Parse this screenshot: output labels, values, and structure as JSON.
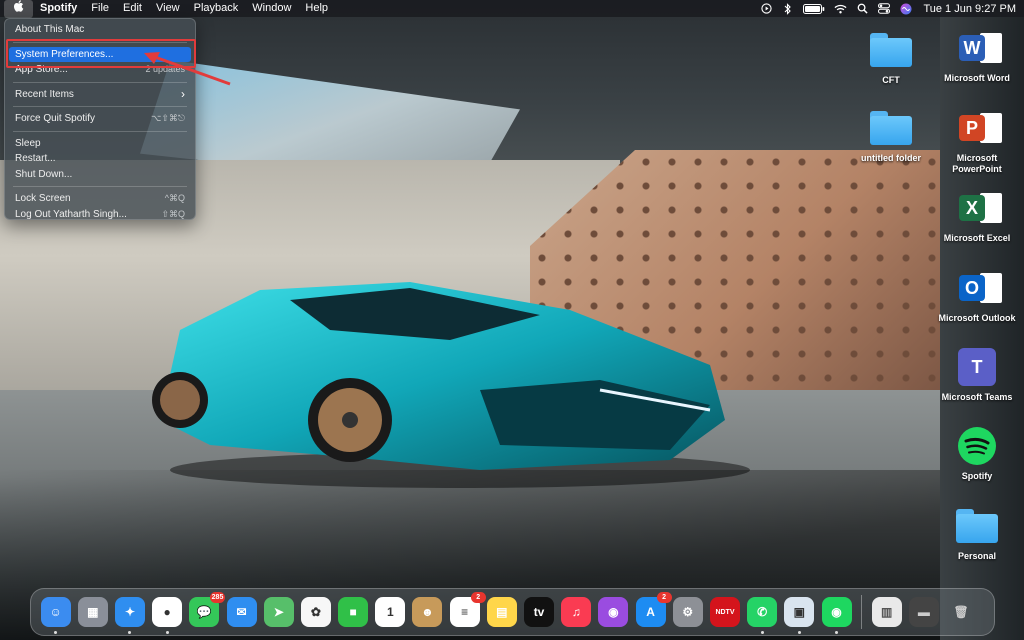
{
  "menubar": {
    "app_name": "Spotify",
    "items": [
      "File",
      "Edit",
      "View",
      "Playback",
      "Window",
      "Help"
    ],
    "status_icons": [
      "play-icon",
      "bluetooth-icon",
      "battery-icon",
      "wifi-icon",
      "spotlight-icon",
      "control-center-icon",
      "siri-icon"
    ],
    "clock": "Tue 1 Jun  9:27 PM"
  },
  "apple_menu": {
    "items": [
      {
        "label": "About This Mac",
        "shortcut": ""
      },
      {
        "label": "System Preferences...",
        "shortcut": ""
      },
      {
        "label": "App Store...",
        "shortcut": "2 updates"
      },
      {
        "label": "Recent Items",
        "shortcut": "›"
      },
      {
        "label": "Force Quit Spotify",
        "shortcut": "⌥⇧⌘⎋"
      },
      {
        "label": "Sleep",
        "shortcut": ""
      },
      {
        "label": "Restart...",
        "shortcut": ""
      },
      {
        "label": "Shut Down...",
        "shortcut": ""
      },
      {
        "label": "Lock Screen",
        "shortcut": "^⌘Q"
      },
      {
        "label": "Log Out Yatharth Singh...",
        "shortcut": "⇧⌘Q"
      }
    ]
  },
  "desktop_icons": [
    {
      "label": "CFT",
      "icon": "folder-icon"
    },
    {
      "label": "Microsoft Word",
      "icon": "word-icon",
      "glyph": "W",
      "color": "#2b5eb6"
    },
    {
      "label": "untitled folder",
      "icon": "folder-icon"
    },
    {
      "label": "Microsoft PowerPoint",
      "icon": "powerpoint-icon",
      "glyph": "P",
      "color": "#d14524"
    },
    {
      "label": "Microsoft Excel",
      "icon": "excel-icon",
      "glyph": "X",
      "color": "#1e7145"
    },
    {
      "label": "Microsoft Outlook",
      "icon": "outlook-icon",
      "glyph": "O",
      "color": "#0a64c8"
    },
    {
      "label": "Microsoft Teams",
      "icon": "teams-icon",
      "glyph": "T",
      "color": "#5b5fc7"
    },
    {
      "label": "Spotify",
      "icon": "spotify-icon"
    },
    {
      "label": "Personal",
      "icon": "folder-icon"
    }
  ],
  "dock": {
    "apps": [
      {
        "name": "finder",
        "glyph": "☺",
        "bg": "#3b8cf0",
        "running": true,
        "badge": ""
      },
      {
        "name": "launchpad",
        "glyph": "▦",
        "bg": "#8a8f99",
        "running": false,
        "badge": ""
      },
      {
        "name": "safari",
        "glyph": "✦",
        "bg": "#2f8ef0",
        "running": true,
        "badge": ""
      },
      {
        "name": "chrome",
        "glyph": "●",
        "bg": "#ffffff",
        "running": true,
        "badge": ""
      },
      {
        "name": "messages",
        "glyph": "💬",
        "bg": "#34c759",
        "running": false,
        "badge": "285"
      },
      {
        "name": "mail",
        "glyph": "✉",
        "bg": "#2f8ef0",
        "running": false,
        "badge": ""
      },
      {
        "name": "maps",
        "glyph": "➤",
        "bg": "#57bf6a",
        "running": false,
        "badge": ""
      },
      {
        "name": "photos",
        "glyph": "✿",
        "bg": "#f7f7f7",
        "running": false,
        "badge": ""
      },
      {
        "name": "facetime",
        "glyph": "■",
        "bg": "#30c048",
        "running": false,
        "badge": ""
      },
      {
        "name": "calendar",
        "glyph": "1",
        "bg": "#ffffff",
        "running": false,
        "badge": ""
      },
      {
        "name": "contacts",
        "glyph": "☻",
        "bg": "#c79a5a",
        "running": false,
        "badge": ""
      },
      {
        "name": "reminders",
        "glyph": "≡",
        "bg": "#ffffff",
        "running": false,
        "badge": "2"
      },
      {
        "name": "notes",
        "glyph": "▤",
        "bg": "#ffd64a",
        "running": false,
        "badge": ""
      },
      {
        "name": "apple-tv",
        "glyph": "tv",
        "bg": "#111111",
        "running": false,
        "badge": ""
      },
      {
        "name": "music",
        "glyph": "♫",
        "bg": "#fa3b52",
        "running": false,
        "badge": ""
      },
      {
        "name": "podcasts",
        "glyph": "◉",
        "bg": "#9a4ce0",
        "running": false,
        "badge": ""
      },
      {
        "name": "app-store",
        "glyph": "A",
        "bg": "#1d8cf2",
        "running": false,
        "badge": "2"
      },
      {
        "name": "system-preferences",
        "glyph": "⚙",
        "bg": "#8d9096",
        "running": false,
        "badge": ""
      },
      {
        "name": "ndtv",
        "glyph": "NDTV",
        "bg": "#d4141c",
        "running": false,
        "badge": ""
      },
      {
        "name": "whatsapp",
        "glyph": "✆",
        "bg": "#25d366",
        "running": true,
        "badge": ""
      },
      {
        "name": "preview",
        "glyph": "▣",
        "bg": "#d9e4ef",
        "running": true,
        "badge": ""
      },
      {
        "name": "spotify",
        "glyph": "◉",
        "bg": "#1ed760",
        "running": true,
        "badge": ""
      }
    ],
    "extras": [
      {
        "name": "downloads-stack",
        "glyph": "▥",
        "bg": "#e9e9e9"
      },
      {
        "name": "screenshot-stack",
        "glyph": "▬",
        "bg": "#444444"
      },
      {
        "name": "trash",
        "glyph": "🗑",
        "bg": "transparent"
      }
    ]
  }
}
